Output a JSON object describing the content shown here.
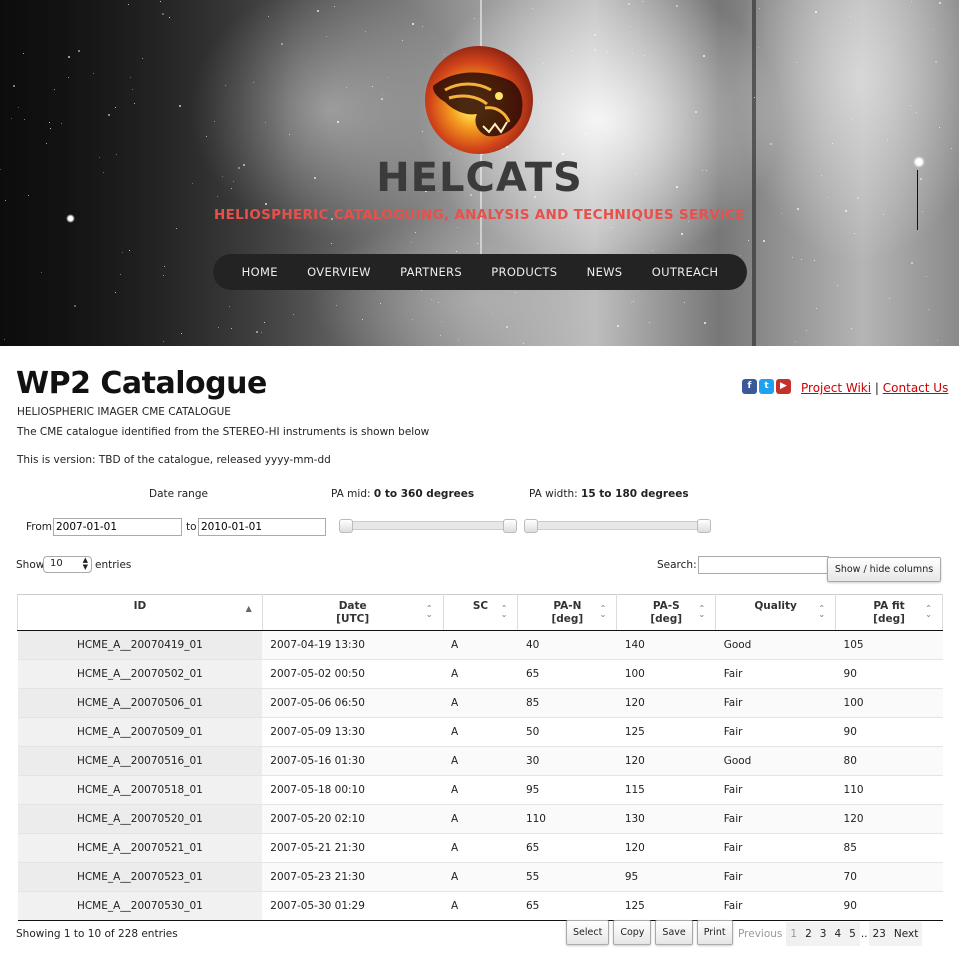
{
  "site": {
    "title": "HELCATS",
    "tagline": "HELIOSPHERIC CATALOGUING, ANALYSIS AND TECHNIQUES SERVICE"
  },
  "nav": [
    "HOME",
    "OVERVIEW",
    "PARTNERS",
    "PRODUCTS",
    "NEWS",
    "OUTREACH"
  ],
  "header_links": {
    "wiki": "Project Wiki",
    "separator": "|",
    "contact": "Contact Us",
    "social": [
      "f",
      "t",
      "▶"
    ]
  },
  "page": {
    "title": "WP2 Catalogue",
    "subtitle": "HELIOSPHERIC IMAGER CME CATALOGUE",
    "description": "The CME catalogue identified from the STEREO-HI instruments is shown below",
    "version": "This is version: TBD of the catalogue, released yyyy-mm-dd"
  },
  "filters": {
    "date_range_label": "Date range",
    "from_label": "From",
    "from_value": "2007-01-01",
    "to_label": "to",
    "to_value": "2010-01-01",
    "pa_mid_label": "PA mid:",
    "pa_mid_value": "0 to 360 degrees",
    "pa_width_label": "PA width:",
    "pa_width_value": "15 to 180 degrees"
  },
  "controls": {
    "show_label": "Show",
    "show_value": "10",
    "entries_label": "entries",
    "search_label": "Search:",
    "col_toggle": "Show / hide columns"
  },
  "table": {
    "headers": [
      {
        "l1": "ID",
        "l2": ""
      },
      {
        "l1": "Date",
        "l2": "[UTC]"
      },
      {
        "l1": "SC",
        "l2": ""
      },
      {
        "l1": "PA-N",
        "l2": "[deg]"
      },
      {
        "l1": "PA-S",
        "l2": "[deg]"
      },
      {
        "l1": "Quality",
        "l2": ""
      },
      {
        "l1": "PA fit",
        "l2": "[deg]"
      }
    ],
    "rows": [
      [
        "HCME_A__20070419_01",
        "2007-04-19 13:30",
        "A",
        "40",
        "140",
        "Good",
        "105"
      ],
      [
        "HCME_A__20070502_01",
        "2007-05-02 00:50",
        "A",
        "65",
        "100",
        "Fair",
        "90"
      ],
      [
        "HCME_A__20070506_01",
        "2007-05-06 06:50",
        "A",
        "85",
        "120",
        "Fair",
        "100"
      ],
      [
        "HCME_A__20070509_01",
        "2007-05-09 13:30",
        "A",
        "50",
        "125",
        "Fair",
        "90"
      ],
      [
        "HCME_A__20070516_01",
        "2007-05-16 01:30",
        "A",
        "30",
        "120",
        "Good",
        "80"
      ],
      [
        "HCME_A__20070518_01",
        "2007-05-18 00:10",
        "A",
        "95",
        "115",
        "Fair",
        "110"
      ],
      [
        "HCME_A__20070520_01",
        "2007-05-20 02:10",
        "A",
        "110",
        "130",
        "Fair",
        "120"
      ],
      [
        "HCME_A__20070521_01",
        "2007-05-21 21:30",
        "A",
        "65",
        "120",
        "Fair",
        "85"
      ],
      [
        "HCME_A__20070523_01",
        "2007-05-23 21:30",
        "A",
        "55",
        "95",
        "Fair",
        "70"
      ],
      [
        "HCME_A__20070530_01",
        "2007-05-30 01:29",
        "A",
        "65",
        "125",
        "Fair",
        "90"
      ]
    ]
  },
  "footer": {
    "info": "Showing 1 to 10 of 228 entries",
    "buttons": [
      "Select",
      "Copy",
      "Save",
      "Print"
    ],
    "pager": {
      "previous": "Previous",
      "pages": [
        "1",
        "2",
        "3",
        "4",
        "5"
      ],
      "ellipsis": "..",
      "last": "23",
      "next": "Next"
    }
  }
}
